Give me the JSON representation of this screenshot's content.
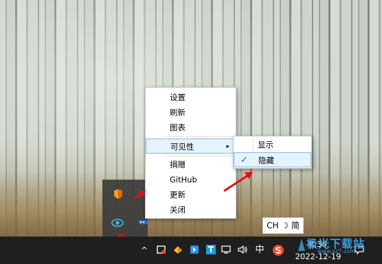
{
  "context_menu": {
    "items": [
      "设置",
      "刷新",
      "图表",
      "可见性",
      "捐赠",
      "GitHub",
      "更新",
      "关闭"
    ],
    "highlighted_index": 3,
    "submenu_arrow": "▸"
  },
  "visibility_submenu": {
    "items": [
      "显示",
      "隐藏"
    ],
    "checked_index": 1,
    "check_mark": "✓"
  },
  "ime_indicator": {
    "text": "CH ☽ 简"
  },
  "taskbar": {
    "overflow_chevron": "^",
    "input_language": "中",
    "time": "8:38",
    "date": "2022-12-19"
  },
  "tray_popup_icons": [
    "shield-icon",
    "eye-icon",
    "network-monitor-icon"
  ],
  "taskbar_icons": [
    "chevron-up-icon",
    "tray-app-icon",
    "file-manager-icon",
    "bookmark-icon",
    "text-app-icon",
    "network-icon",
    "volume-icon",
    "sogou-input-icon",
    "notification-icon"
  ],
  "watermark": {
    "line1": "极光下载站",
    "line2": "www.xz7.com"
  },
  "colors": {
    "highlight_bg": "#e5f3ff",
    "highlight_border": "#7fb8e6",
    "taskbar_bg": "#1f1f1f",
    "annotation_arrow": "#e01010"
  }
}
